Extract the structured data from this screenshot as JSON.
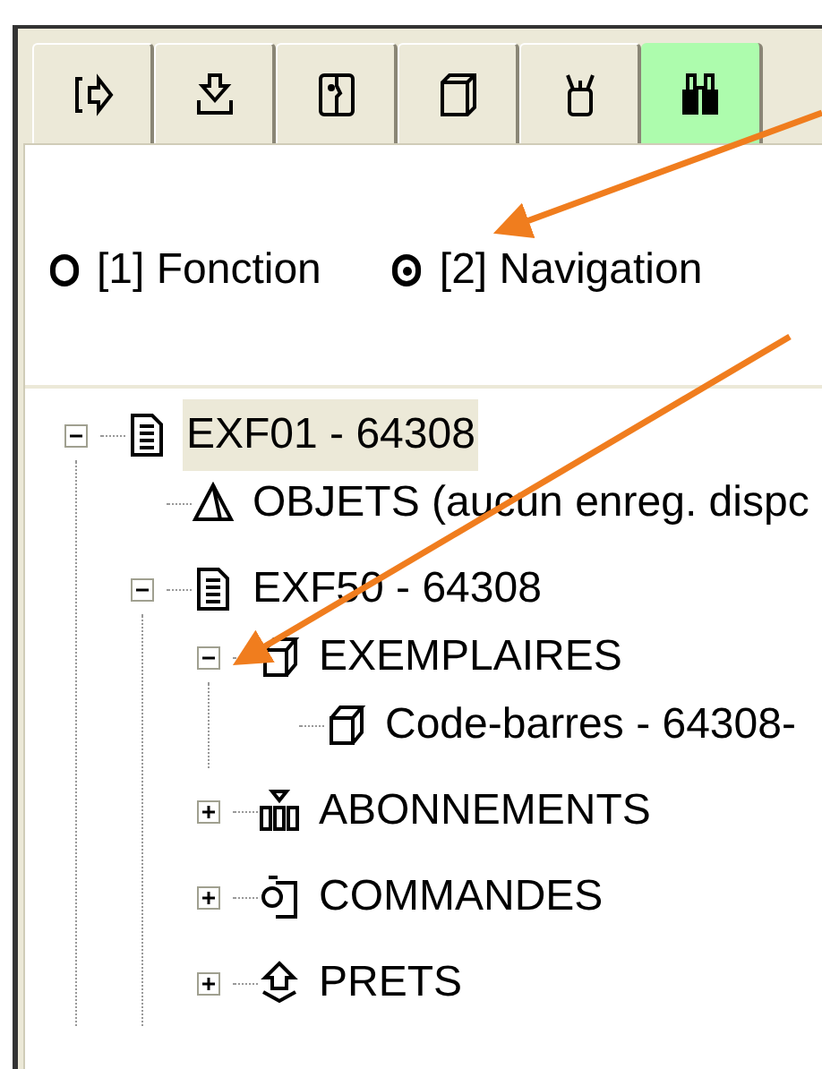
{
  "tabs": [
    {
      "kind": "exit",
      "selected": false
    },
    {
      "kind": "download",
      "selected": false
    },
    {
      "kind": "face",
      "selected": false
    },
    {
      "kind": "pages",
      "selected": false
    },
    {
      "kind": "cup",
      "selected": false
    },
    {
      "kind": "binoculars",
      "selected": true
    }
  ],
  "mode_options": [
    {
      "label": "[1] Fonction",
      "selected": false
    },
    {
      "label": "[2] Navigation",
      "selected": true
    }
  ],
  "tree": [
    {
      "label": "EXF01 - 64308",
      "kind": "document",
      "expanded": true,
      "selected": true,
      "children": [
        {
          "label": "OBJETS (aucun enreg. dispc",
          "kind": "pyramid",
          "selected": false
        },
        {
          "label": "EXF50 - 64308",
          "kind": "document",
          "expanded": true,
          "selected": false,
          "children": [
            {
              "label": "EXEMPLAIRES",
              "kind": "cube",
              "expanded": true,
              "selected": false,
              "children": [
                {
                  "label": "Code-barres - 64308-",
                  "kind": "cube",
                  "selected": false
                }
              ]
            },
            {
              "label": "ABONNEMENTS",
              "kind": "subscriptions",
              "expanded": false,
              "selected": false
            },
            {
              "label": "COMMANDES",
              "kind": "order",
              "expanded": false,
              "selected": false
            },
            {
              "label": "PRETS",
              "kind": "loan",
              "expanded": false,
              "selected": false
            }
          ]
        }
      ]
    }
  ]
}
